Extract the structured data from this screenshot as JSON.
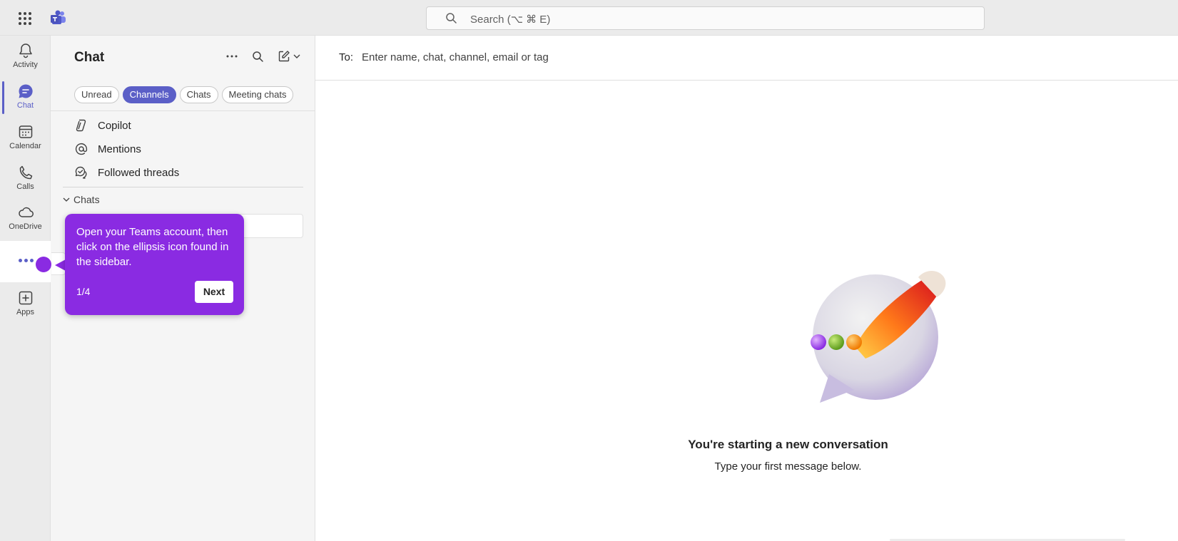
{
  "topbar": {
    "search_placeholder": "Search (⌥ ⌘ E)",
    "app_launcher_icon": "waffle-icon",
    "logo_icon": "teams-logo"
  },
  "rail": {
    "items": [
      {
        "label": "Activity",
        "icon": "bell-icon"
      },
      {
        "label": "Chat",
        "icon": "chat-icon",
        "active": true
      },
      {
        "label": "Calendar",
        "icon": "calendar-icon"
      },
      {
        "label": "Calls",
        "icon": "phone-icon"
      },
      {
        "label": "OneDrive",
        "icon": "cloud-icon"
      },
      {
        "label": "",
        "icon": "ellipsis-icon"
      },
      {
        "label": "Apps",
        "icon": "plus-square-icon"
      }
    ]
  },
  "pane": {
    "title": "Chat",
    "filters": [
      {
        "label": "Unread"
      },
      {
        "label": "Channels",
        "active": true
      },
      {
        "label": "Chats"
      },
      {
        "label": "Meeting chats"
      }
    ],
    "nav": [
      {
        "label": "Copilot",
        "icon": "copilot-icon"
      },
      {
        "label": "Mentions",
        "icon": "at-icon"
      },
      {
        "label": "Followed threads",
        "icon": "followed-threads-icon"
      }
    ],
    "section_label": "Chats"
  },
  "tooltip": {
    "text": "Open your Teams account, then click on the ellipsis icon found in the sidebar.",
    "step": "1/4",
    "next_label": "Next"
  },
  "main": {
    "to_label": "To:",
    "to_placeholder": "Enter name, chat, channel, email or tag",
    "empty_title": "You're starting a new conversation",
    "empty_subtitle": "Type your first message below."
  },
  "colors": {
    "accent": "#5b5fc7",
    "tooltip": "#8a2be2"
  }
}
